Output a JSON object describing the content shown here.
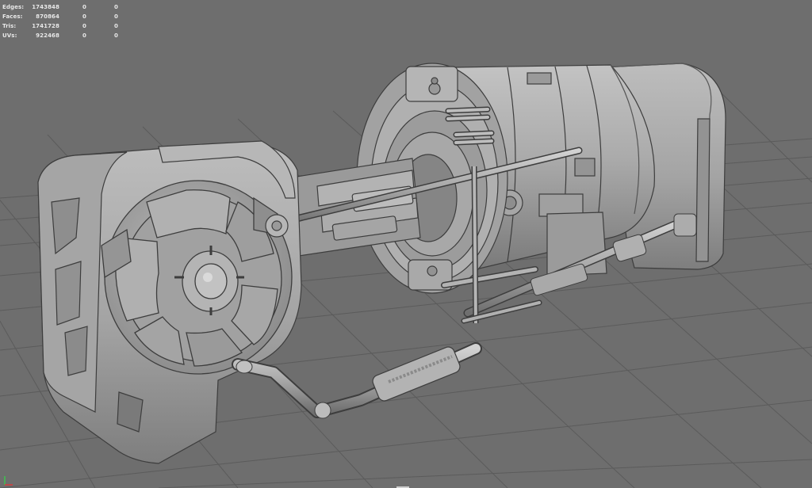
{
  "hud": {
    "rows": [
      {
        "label": "Edges:",
        "value": "1743848",
        "selected": "0",
        "component": "0"
      },
      {
        "label": "Faces:",
        "value": "870864",
        "selected": "0",
        "component": "0"
      },
      {
        "label": "Tris:",
        "value": "1741728",
        "selected": "0",
        "component": "0"
      },
      {
        "label": "UVs:",
        "value": "922468",
        "selected": "0",
        "component": "0"
      }
    ]
  },
  "colors": {
    "background": "#6e6e6e",
    "grid": "#5a5a5a",
    "model": "#a9a9a9",
    "model_shadow": "#7b7b7b",
    "model_edge": "#3d3d3d",
    "hud_text": "#e8e8e8",
    "axis_x": "#d83b3b",
    "axis_y": "#3fc24f"
  },
  "icons": {
    "axis": "view-axis-icon"
  }
}
